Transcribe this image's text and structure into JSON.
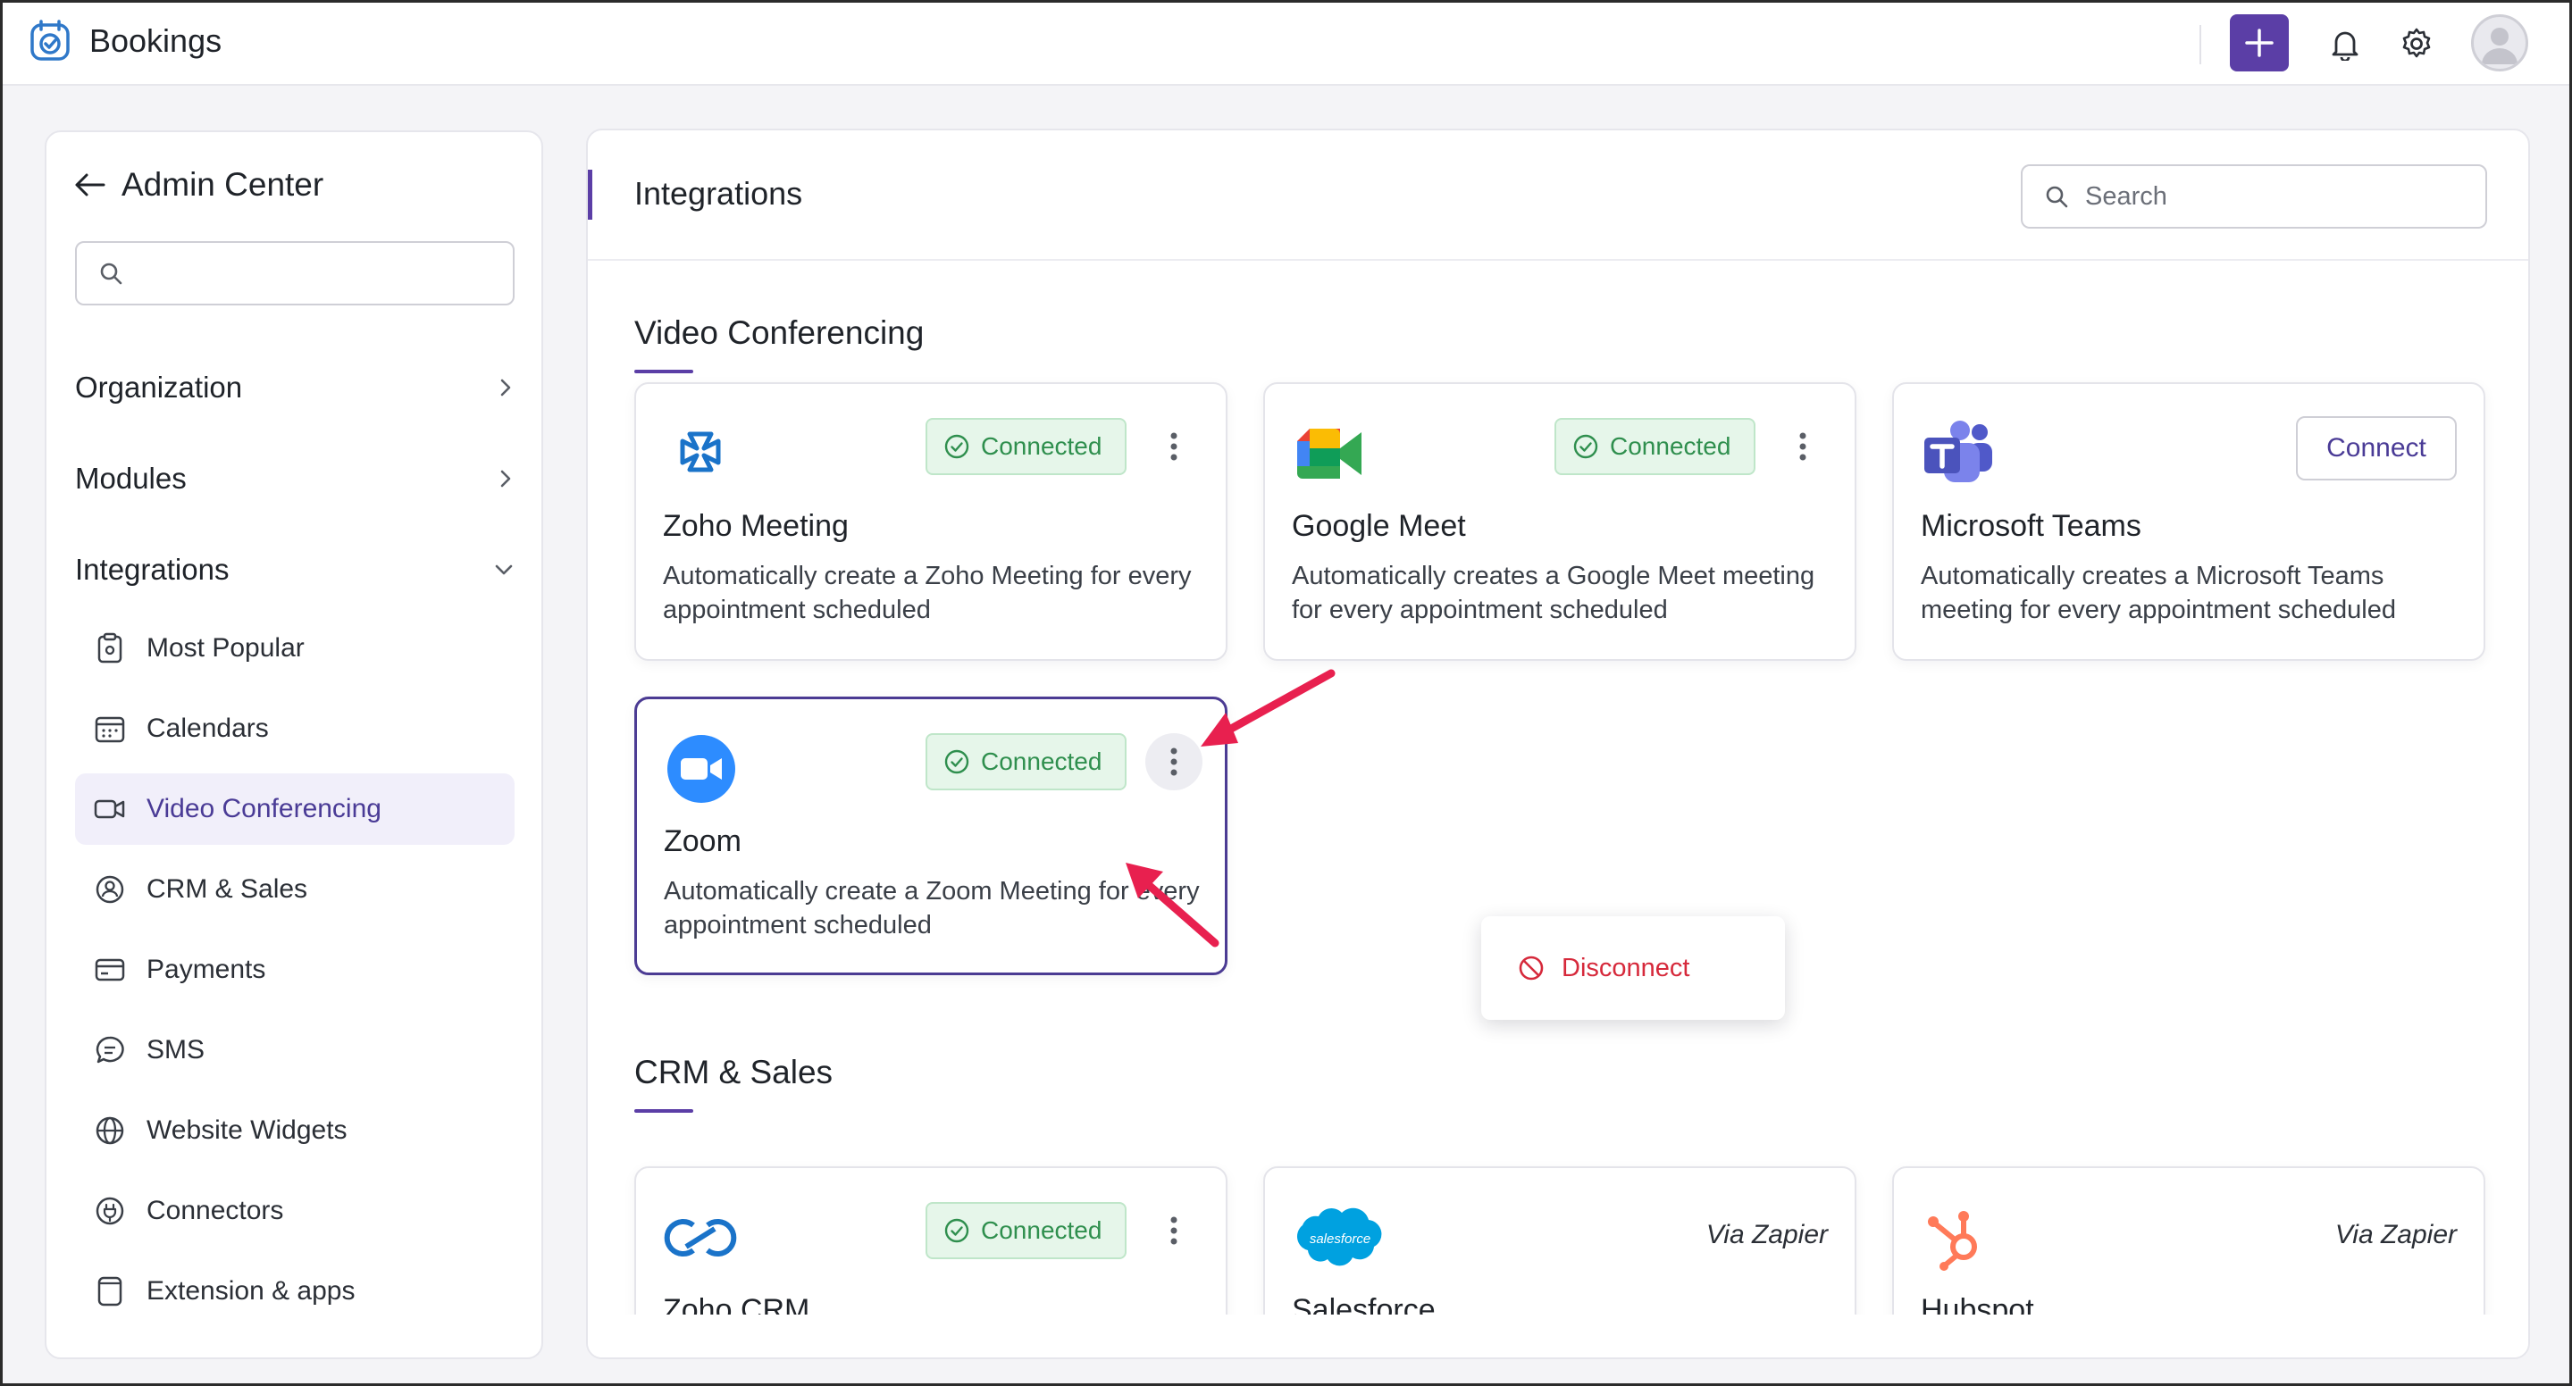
{
  "app": {
    "name": "Bookings"
  },
  "colors": {
    "accent": "#5b3ea6",
    "connected_bg": "#e6f6ea",
    "connected_text": "#2f8f4e",
    "danger": "#d6293b",
    "annotation": "#e8204f"
  },
  "sidebar": {
    "back_title": "Admin Center",
    "search_placeholder": "",
    "sections": [
      {
        "label": "Organization",
        "icon": "chevron-right-icon"
      },
      {
        "label": "Modules",
        "icon": "chevron-right-icon"
      },
      {
        "label": "Integrations",
        "icon": "chevron-down-icon"
      }
    ],
    "items": [
      {
        "label": "Most Popular",
        "icon": "clipboard-star-icon"
      },
      {
        "label": "Calendars",
        "icon": "calendar-icon"
      },
      {
        "label": "Video Conferencing",
        "icon": "video-icon",
        "active": true
      },
      {
        "label": "CRM & Sales",
        "icon": "crm-icon"
      },
      {
        "label": "Payments",
        "icon": "card-icon"
      },
      {
        "label": "SMS",
        "icon": "chat-icon"
      },
      {
        "label": "Website Widgets",
        "icon": "globe-icon"
      },
      {
        "label": "Connectors",
        "icon": "plug-icon"
      },
      {
        "label": "Extension & apps",
        "icon": "extension-icon"
      }
    ]
  },
  "main": {
    "title": "Integrations",
    "search_placeholder": "Search",
    "sections": [
      {
        "title": "Video Conferencing",
        "cards": [
          {
            "name": "Zoho Meeting",
            "desc": "Automatically create a Zoho Meeting for every appointment scheduled",
            "status": "Connected"
          },
          {
            "name": "Google Meet",
            "desc": "Automatically creates a Google Meet meeting for every appointment scheduled",
            "status": "Connected"
          },
          {
            "name": "Microsoft Teams",
            "desc": "Automatically creates a Microsoft Teams meeting for every appointment scheduled",
            "action": "Connect"
          },
          {
            "name": "Zoom",
            "desc": "Automatically create a Zoom Meeting for every appointment scheduled",
            "status": "Connected"
          }
        ]
      },
      {
        "title": "CRM & Sales",
        "cards": [
          {
            "name": "Zoho CRM",
            "status": "Connected"
          },
          {
            "name": "Salesforce",
            "via": "Via Zapier",
            "logo_text": "salesforce"
          },
          {
            "name": "Hubspot",
            "via": "Via Zapier"
          }
        ]
      }
    ],
    "menu": {
      "disconnect_label": "Disconnect"
    }
  }
}
